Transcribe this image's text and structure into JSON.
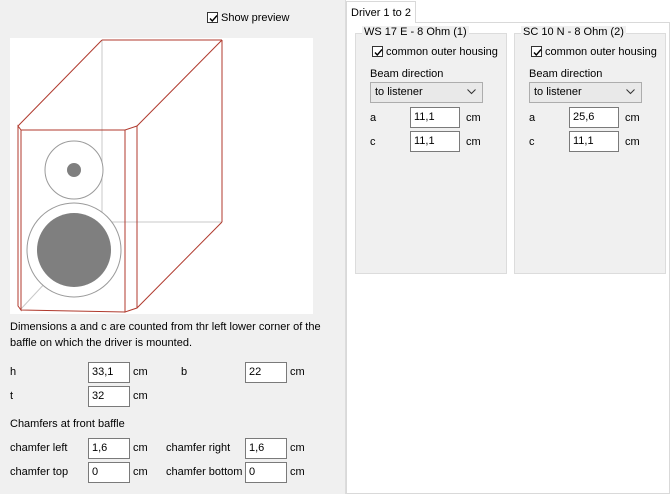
{
  "preview": {
    "show_label": "Show preview",
    "checked": true
  },
  "note": {
    "line1": "Dimensions a and c are counted from thr left lower corner of the",
    "line2": "baffle on which the driver is mounted."
  },
  "dims": {
    "h_label": "h",
    "h_value": "33,1",
    "h_unit": "cm",
    "b_label": "b",
    "b_value": "22",
    "b_unit": "cm",
    "t_label": "t",
    "t_value": "32",
    "t_unit": "cm"
  },
  "chamfers": {
    "title": "Chamfers at front baffle",
    "left_label": "chamfer left",
    "left_value": "1,6",
    "left_unit": "cm",
    "right_label": "chamfer right",
    "right_value": "1,6",
    "right_unit": "cm",
    "top_label": "chamfer top",
    "top_value": "0",
    "top_unit": "cm",
    "bottom_label": "chamfer bottom",
    "bottom_value": "0",
    "bottom_unit": "cm"
  },
  "tab": {
    "label": "Driver 1 to 2"
  },
  "drivers": [
    {
      "title": "WS 17 E - 8 Ohm   (1)",
      "housing_label": "common outer housing",
      "beam_label": "Beam direction",
      "beam_value": "to listener",
      "a_label": "a",
      "a_value": "11,1",
      "a_unit": "cm",
      "c_label": "c",
      "c_value": "11,1",
      "c_unit": "cm"
    },
    {
      "title": "SC 10 N - 8 Ohm (2)",
      "housing_label": "common outer housing",
      "beam_label": "Beam direction",
      "beam_value": "to listener",
      "a_label": "a",
      "a_value": "25,6",
      "a_unit": "cm",
      "c_label": "c",
      "c_value": "11,1",
      "c_unit": "cm"
    }
  ],
  "colors": {
    "outline": "#b03a2e",
    "driver_fill": "#7f7f7f",
    "hidden_line": "#c8c8c8"
  }
}
